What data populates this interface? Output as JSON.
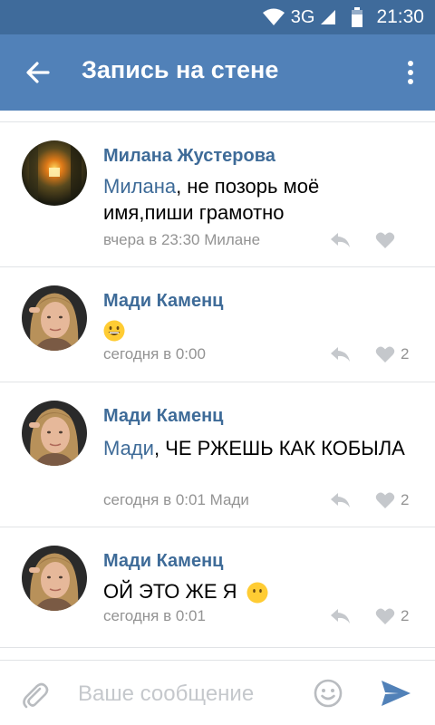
{
  "status_bar": {
    "network": "3G",
    "time": "21:30",
    "icons": [
      "wifi-icon",
      "signal-icon",
      "battery-icon"
    ]
  },
  "app_bar": {
    "title": "Запись на стене",
    "back_icon": "back-arrow-icon",
    "menu_icon": "more-vertical-icon"
  },
  "comments": [
    {
      "author": "Милана Жустерова",
      "mention": "Милана",
      "text": ", не позорь моё имя,пиши грамотно",
      "meta": "вчера в 23:30 Милане",
      "likes": "",
      "avatar": "avatar-milana"
    },
    {
      "author": "Мади Каменц",
      "mention": "",
      "text": "",
      "emoji": "grinning-face-emoji",
      "meta": "сегодня в 0:00",
      "likes": "2",
      "avatar": "avatar-madi"
    },
    {
      "author": "Мади Каменц",
      "mention": "Мади",
      "text": ", ЧЕ РЖЕШЬ КАК КОБЫЛА",
      "meta": "сегодня в 0:01 Мади",
      "likes": "2",
      "avatar": "avatar-madi"
    },
    {
      "author": "Мади Каменц",
      "mention": "",
      "text": "ОЙ ЭТО ЖЕ Я",
      "emoji": "face-without-mouth-emoji",
      "meta": "сегодня в 0:01",
      "likes": "2",
      "avatar": "avatar-madi"
    }
  ],
  "composer": {
    "placeholder": "Ваше сообщение",
    "value": "",
    "attach_icon": "paperclip-icon",
    "emoji_icon": "smiley-icon",
    "send_icon": "send-icon"
  },
  "colors": {
    "status_bar": "#3f6b9b",
    "app_bar": "#5181b8",
    "link": "#3e6b98",
    "meta": "#939393",
    "icon_gray": "#c5c8cc",
    "send": "#5181b8"
  }
}
